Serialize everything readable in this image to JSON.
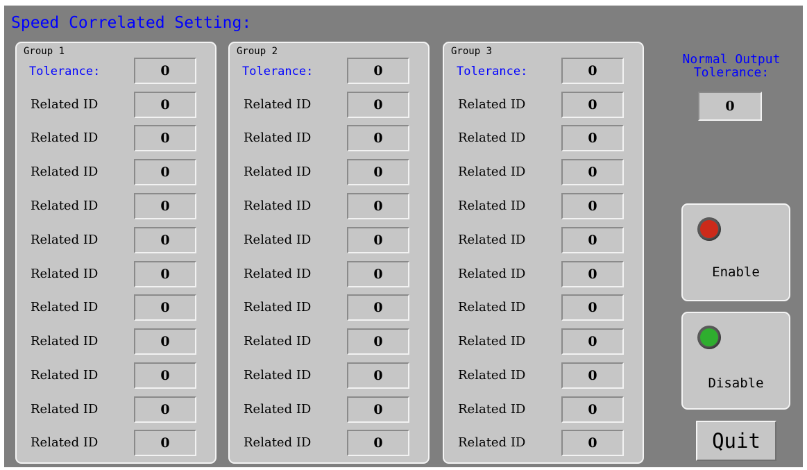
{
  "title": "Speed Correlated Setting:",
  "groups": [
    {
      "name": "Group 1",
      "tolerance_label": "Tolerance:",
      "tolerance_value": "0",
      "related_label": "Related ID",
      "related_values": [
        "0",
        "0",
        "0",
        "0",
        "0",
        "0",
        "0",
        "0",
        "0",
        "0",
        "0"
      ]
    },
    {
      "name": "Group 2",
      "tolerance_label": "Tolerance:",
      "tolerance_value": "0",
      "related_label": "Related ID",
      "related_values": [
        "0",
        "0",
        "0",
        "0",
        "0",
        "0",
        "0",
        "0",
        "0",
        "0",
        "0"
      ]
    },
    {
      "name": "Group 3",
      "tolerance_label": "Tolerance:",
      "tolerance_value": "0",
      "related_label": "Related ID",
      "related_values": [
        "0",
        "0",
        "0",
        "0",
        "0",
        "0",
        "0",
        "0",
        "0",
        "0",
        "0"
      ]
    }
  ],
  "normal_output": {
    "label_line1": "Normal Output",
    "label_line2": "Tolerance:",
    "value": "0"
  },
  "enable_button": {
    "label": "Enable",
    "lamp_color": "#cc2a1a"
  },
  "disable_button": {
    "label": "Disable",
    "lamp_color": "#2fae2f"
  },
  "quit_button": {
    "label": "Quit"
  },
  "colors": {
    "background": "#7f7f7f",
    "panel": "#c6c6c6",
    "accent_text": "#0000ff"
  }
}
